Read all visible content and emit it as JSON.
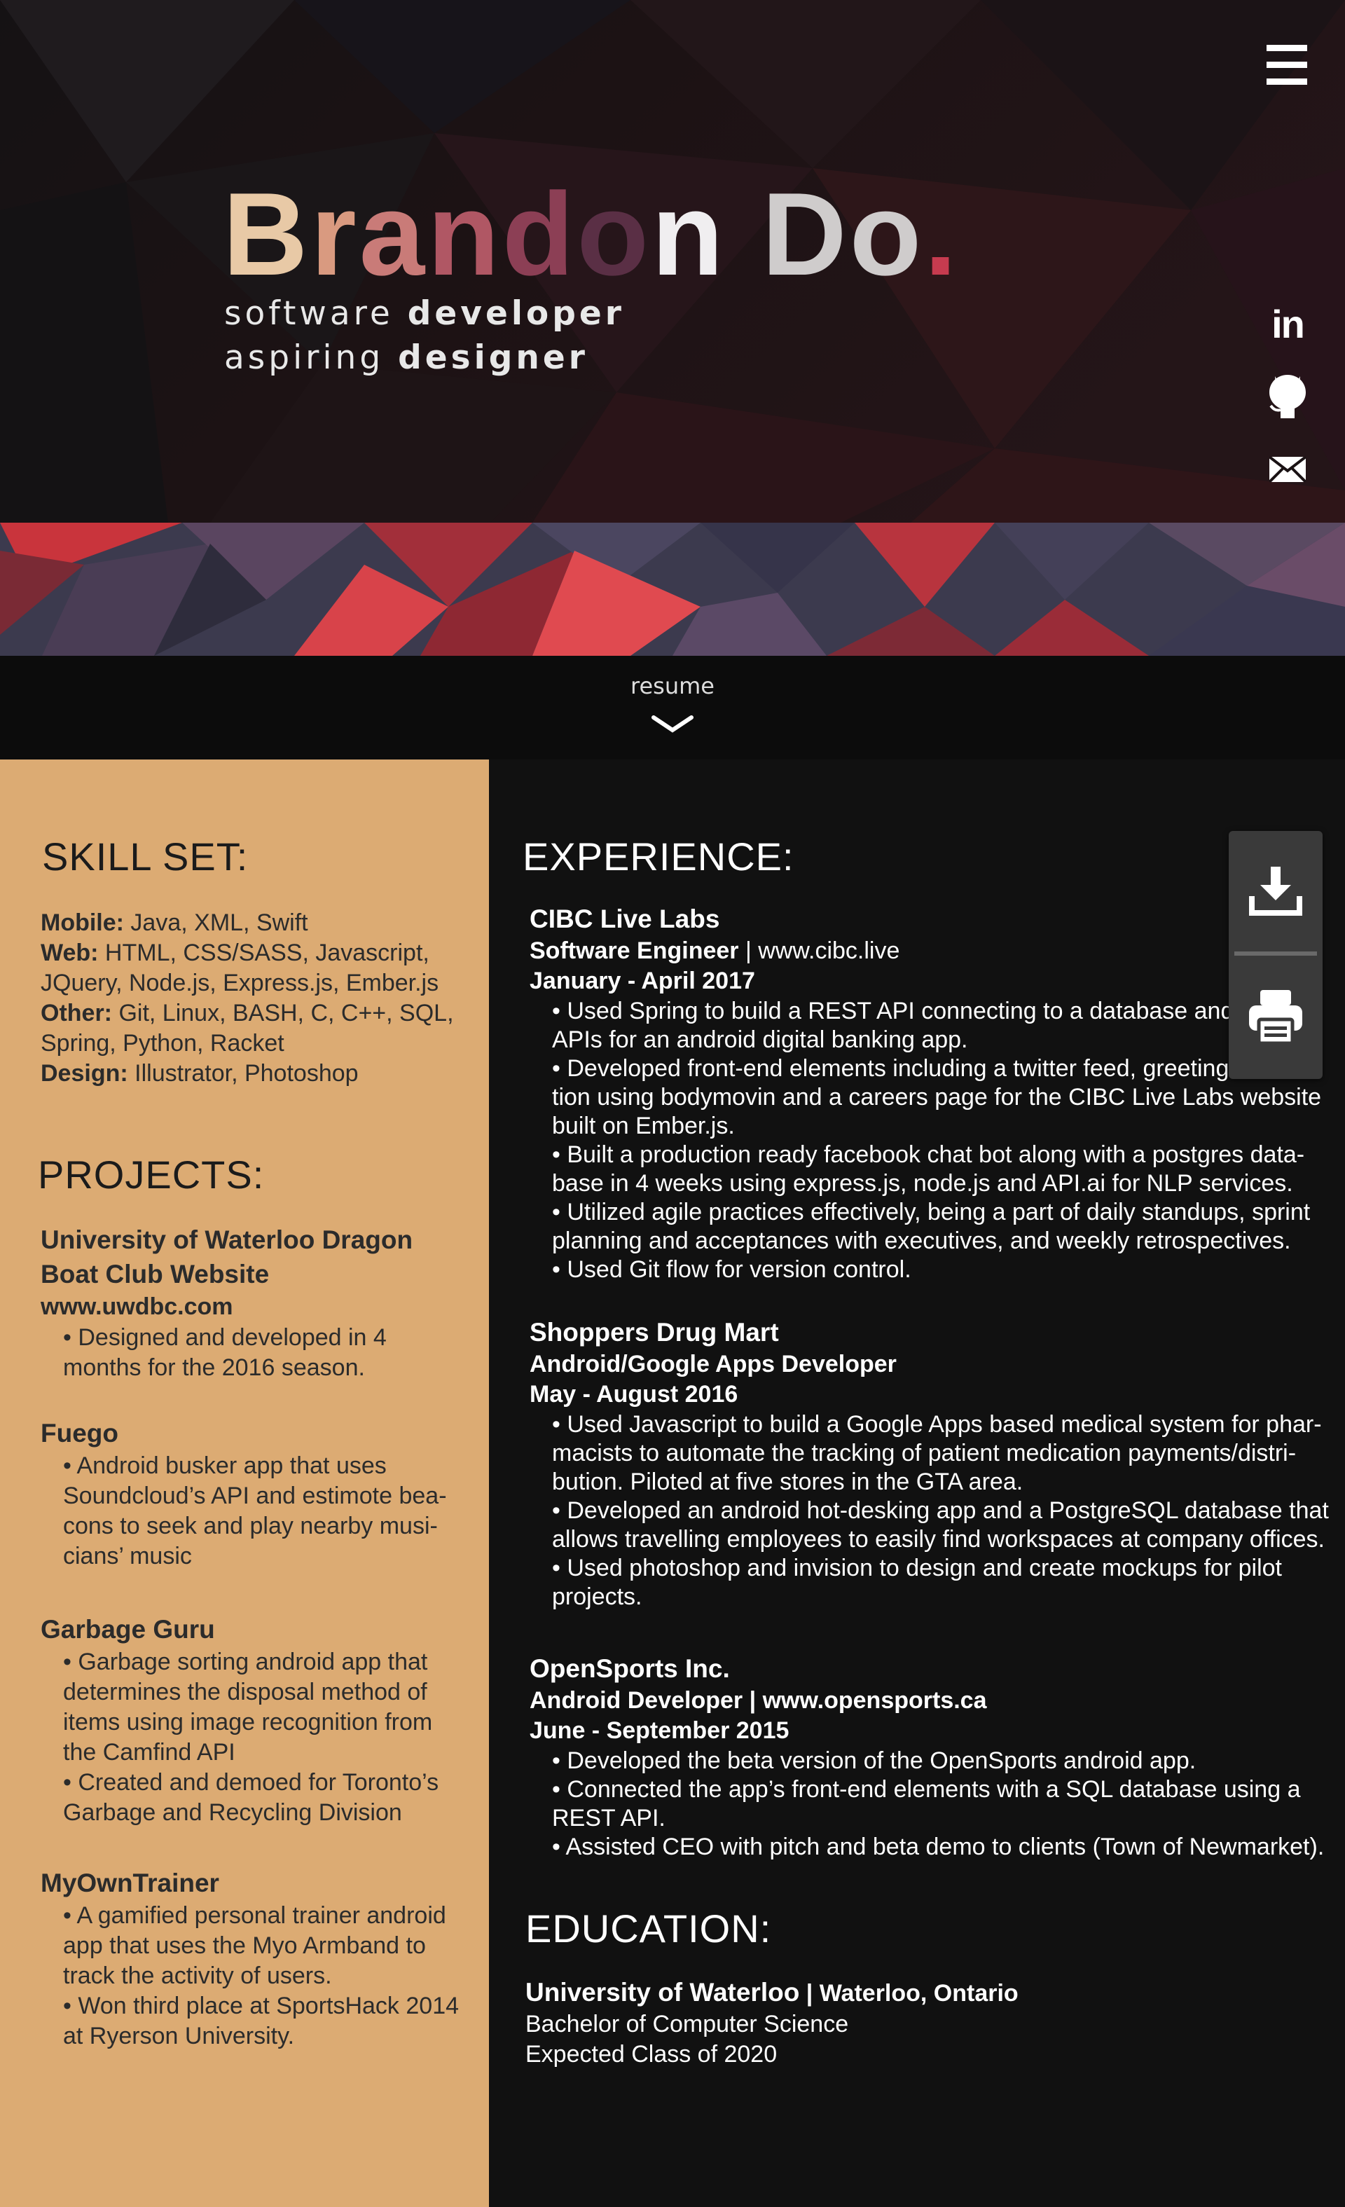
{
  "hero": {
    "name_chars": [
      "B",
      "r",
      "a",
      "n",
      "d",
      "o",
      "n",
      " ",
      "D",
      "o",
      "."
    ],
    "tagline1_light": "software ",
    "tagline1_bold": "developer",
    "tagline2_light": "aspiring ",
    "tagline2_bold": "designer"
  },
  "nav": {
    "menu_icon": "hamburger-menu-icon"
  },
  "social": [
    {
      "name": "linkedin",
      "icon": "linkedin-icon",
      "text": "in"
    },
    {
      "name": "github",
      "icon": "github-icon"
    },
    {
      "name": "email",
      "icon": "envelope-icon"
    }
  ],
  "resume_link": {
    "label": "resume",
    "icon": "chevron-down-icon"
  },
  "tools": [
    {
      "name": "download",
      "icon": "download-icon"
    },
    {
      "name": "print",
      "icon": "printer-icon"
    }
  ],
  "skills": {
    "heading": "SKILL SET:",
    "rows": [
      {
        "label": "Mobile:",
        "text": " Java, XML, Swift"
      },
      {
        "label": "Web:",
        "text": " HTML, CSS/SASS, Javascript,"
      },
      {
        "label": "",
        "text": "JQuery, Node.js, Express.js, Ember.js"
      },
      {
        "label": "Other:",
        "text": " Git, Linux, BASH, C, C++, SQL,"
      },
      {
        "label": "",
        "text": "Spring, Python, Racket"
      },
      {
        "label": "Design:",
        "text": " Illustrator, Photoshop"
      }
    ]
  },
  "projects": {
    "heading": "PROJECTS:",
    "items": [
      {
        "title_lines": [
          "University of Waterloo Dragon",
          "Boat Club Website",
          "www.uwdbc.com"
        ],
        "desc_lines": [
          "• Designed and developed in 4",
          "months for the 2016 season."
        ]
      },
      {
        "title_lines": [
          "Fuego"
        ],
        "desc_lines": [
          "• Android busker app that uses",
          "Soundcloud’s API and estimote bea-",
          "cons to seek and play nearby musi-",
          "cians’ music"
        ]
      },
      {
        "title_lines": [
          "Garbage Guru"
        ],
        "desc_lines": [
          "• Garbage sorting android app that",
          "determines the disposal method of",
          "items using image recognition from",
          "the Camfind API",
          "• Created and demoed for Toronto’s",
          "Garbage and Recycling Division"
        ]
      },
      {
        "title_lines": [
          "MyOwnTrainer"
        ],
        "desc_lines": [
          "• A gamified personal trainer android",
          "app that uses the Myo Armband to",
          "track the activity of users.",
          "• Won third place at SportsHack 2014",
          "at Ryerson University."
        ]
      }
    ]
  },
  "experience": {
    "heading": "EXPERIENCE:",
    "jobs": [
      {
        "company": "CIBC Live Labs",
        "role": "Software Engineer",
        "role_extra": " | www.cibc.live",
        "dates": "January - April 2017",
        "bullets": [
          "• Used Spring to build a REST API connecting to a database and exter",
          "APIs for an android digital banking app.",
          "• Developed front-end elements including a twitter feed, greeting ani",
          "tion using bodymovin and a careers page for the CIBC Live Labs website",
          "built on Ember.js.",
          "• Built a production ready facebook chat bot along with a postgres data-",
          "base in 4 weeks using express.js, node.js and API.ai for NLP services.",
          "• Utilized agile practices effectively, being a part of daily standups, sprint",
          "planning and acceptances with executives, and weekly retrospectives.",
          "•  Used Git flow for version control."
        ]
      },
      {
        "company": "Shoppers Drug Mart",
        "role": "Android/Google Apps Developer",
        "role_extra": "",
        "dates": "May - August 2016",
        "bullets": [
          "• Used Javascript to build a  Google Apps based medical system for phar-",
          "macists to automate the tracking of patient medication payments/distri-",
          "bution. Piloted at five stores in the GTA area.",
          "• Developed an android hot-desking app and a PostgreSQL database that",
          "allows travelling employees to easily find workspaces at company offices.",
          "• Used photoshop and invision to design and create mockups for pilot",
          "projects."
        ]
      },
      {
        "company": "OpenSports Inc.",
        "role": "Android Developer",
        "role_extra": " | www.opensports.ca",
        "dates": "June - September 2015",
        "bullets": [
          "• Developed the beta version of the OpenSports android app.",
          "• Connected the app’s front-end elements with a SQL database using a",
          "REST API.",
          "• Assisted CEO with pitch and beta demo to clients (Town of Newmarket)."
        ]
      }
    ]
  },
  "education": {
    "heading": "EDUCATION:",
    "school": "University of Waterloo",
    "location": " | Waterloo, Ontario",
    "degree": "Bachelor of Computer Science",
    "class": "Expected Class of 2020"
  }
}
